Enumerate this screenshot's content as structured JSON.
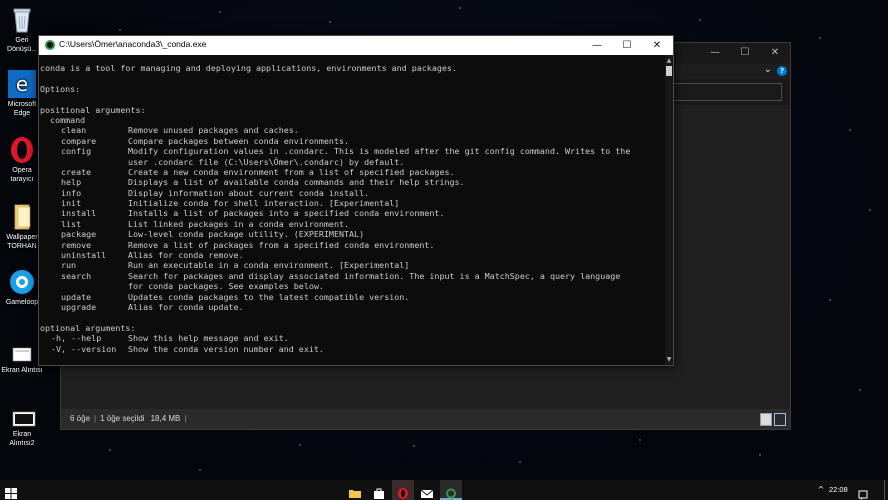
{
  "desktop": {
    "icons": [
      {
        "label_line1": "Geri",
        "label_line2": "Dönüşü..."
      },
      {
        "label_line1": "Microsoft",
        "label_line2": "Edge"
      },
      {
        "label_line1": "Opera",
        "label_line2": "tarayıcı"
      },
      {
        "label_line1": "Wallpaper",
        "label_line2": "TORHAN"
      },
      {
        "label_line1": "Gameloop",
        "label_line2": ""
      },
      {
        "label_line1": "Ekran Alıntısı",
        "label_line2": ""
      },
      {
        "label_line1": "Ekran",
        "label_line2": "Alıntısı2"
      }
    ]
  },
  "explorer": {
    "status": {
      "item_count": "6 öğe",
      "selected": "1 öğe seçildi",
      "size": "18,4 MB"
    },
    "minimize_glyph": "—",
    "maximize_glyph": "☐",
    "close_glyph": "✕",
    "chevron_glyph": "⌄",
    "help_glyph": "?"
  },
  "console": {
    "title": "C:\\Users\\Ömer\\anaconda3\\_conda.exe",
    "minimize_glyph": "—",
    "maximize_glyph": "☐",
    "close_glyph": "✕",
    "scroll_up": "▲",
    "scroll_down": "▼",
    "intro": "conda is a tool for managing and deploying applications, environments and packages.",
    "options_header": "Options:",
    "positional_header": "positional arguments:",
    "command_label": "  command",
    "commands": [
      {
        "name": "clean",
        "desc": "Remove unused packages and caches."
      },
      {
        "name": "compare",
        "desc": "Compare packages between conda environments."
      },
      {
        "name": "config",
        "desc": "Modify configuration values in .condarc. This is modeled after the git config command. Writes to the"
      },
      {
        "name": "",
        "desc": "user .condarc file (C:\\Users\\Ömer\\.condarc) by default."
      },
      {
        "name": "create",
        "desc": "Create a new conda environment from a list of specified packages."
      },
      {
        "name": "help",
        "desc": "Displays a list of available conda commands and their help strings."
      },
      {
        "name": "info",
        "desc": "Display information about current conda install."
      },
      {
        "name": "init",
        "desc": "Initialize conda for shell interaction. [Experimental]"
      },
      {
        "name": "install",
        "desc": "Installs a list of packages into a specified conda environment."
      },
      {
        "name": "list",
        "desc": "List linked packages in a conda environment."
      },
      {
        "name": "package",
        "desc": "Low-level conda package utility. (EXPERIMENTAL)"
      },
      {
        "name": "remove",
        "desc": "Remove a list of packages from a specified conda environment."
      },
      {
        "name": "uninstall",
        "desc": "Alias for conda remove."
      },
      {
        "name": "run",
        "desc": "Run an executable in a conda environment. [Experimental]"
      },
      {
        "name": "search",
        "desc": "Search for packages and display associated information. The input is a MatchSpec, a query language"
      },
      {
        "name": "",
        "desc": "for conda packages. See examples below."
      },
      {
        "name": "update",
        "desc": "Updates conda packages to the latest compatible version."
      },
      {
        "name": "upgrade",
        "desc": "Alias for conda update."
      }
    ],
    "optional_header": "optional arguments:",
    "optional": [
      {
        "name": "-h, --help",
        "desc": "Show this help message and exit."
      },
      {
        "name": "-V, --version",
        "desc": "Show the conda version number and exit."
      }
    ]
  },
  "taskbar": {
    "clock": "22:08",
    "tray_chevron": "^"
  },
  "colors": {
    "console_bg": "#0c0c0c",
    "console_text": "#cccccc",
    "accent": "#0078d7"
  }
}
